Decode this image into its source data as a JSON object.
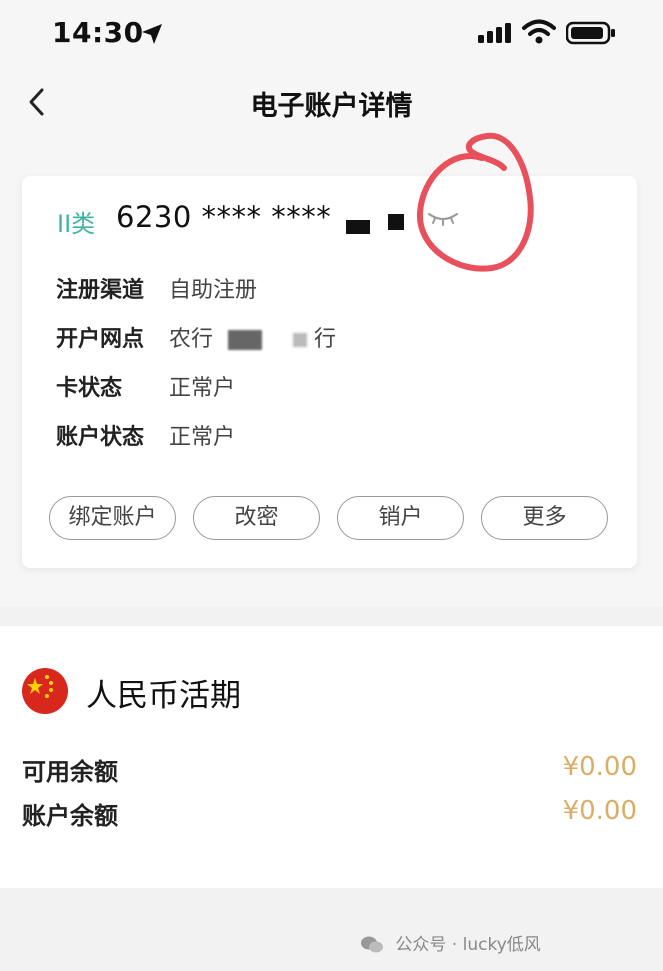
{
  "status_bar": {
    "time": "14:30"
  },
  "header": {
    "title": "电子账户详情"
  },
  "card": {
    "type": "II类",
    "number_visible": "6230 **** ****",
    "fields": [
      {
        "label": "注册渠道",
        "value": "自助注册"
      },
      {
        "label": "开户网点",
        "value_prefix": "农行",
        "value_suffix": "行"
      },
      {
        "label": "卡状态",
        "value": "正常户"
      },
      {
        "label": "账户状态",
        "value": "正常户"
      }
    ],
    "buttons": [
      "绑定账户",
      "改密",
      "销户",
      "更多"
    ]
  },
  "balance": {
    "currency_title": "人民币活期",
    "rows": [
      {
        "label": "可用余额",
        "amount": "¥0.00"
      },
      {
        "label": "账户余额",
        "amount": "¥0.00"
      }
    ]
  },
  "footer": {
    "text": "公众号 · lucky低风"
  },
  "colors": {
    "type_green": "#3fb5a1",
    "amount_gold": "#d9ae66",
    "annotation_red": "#e8505b"
  }
}
